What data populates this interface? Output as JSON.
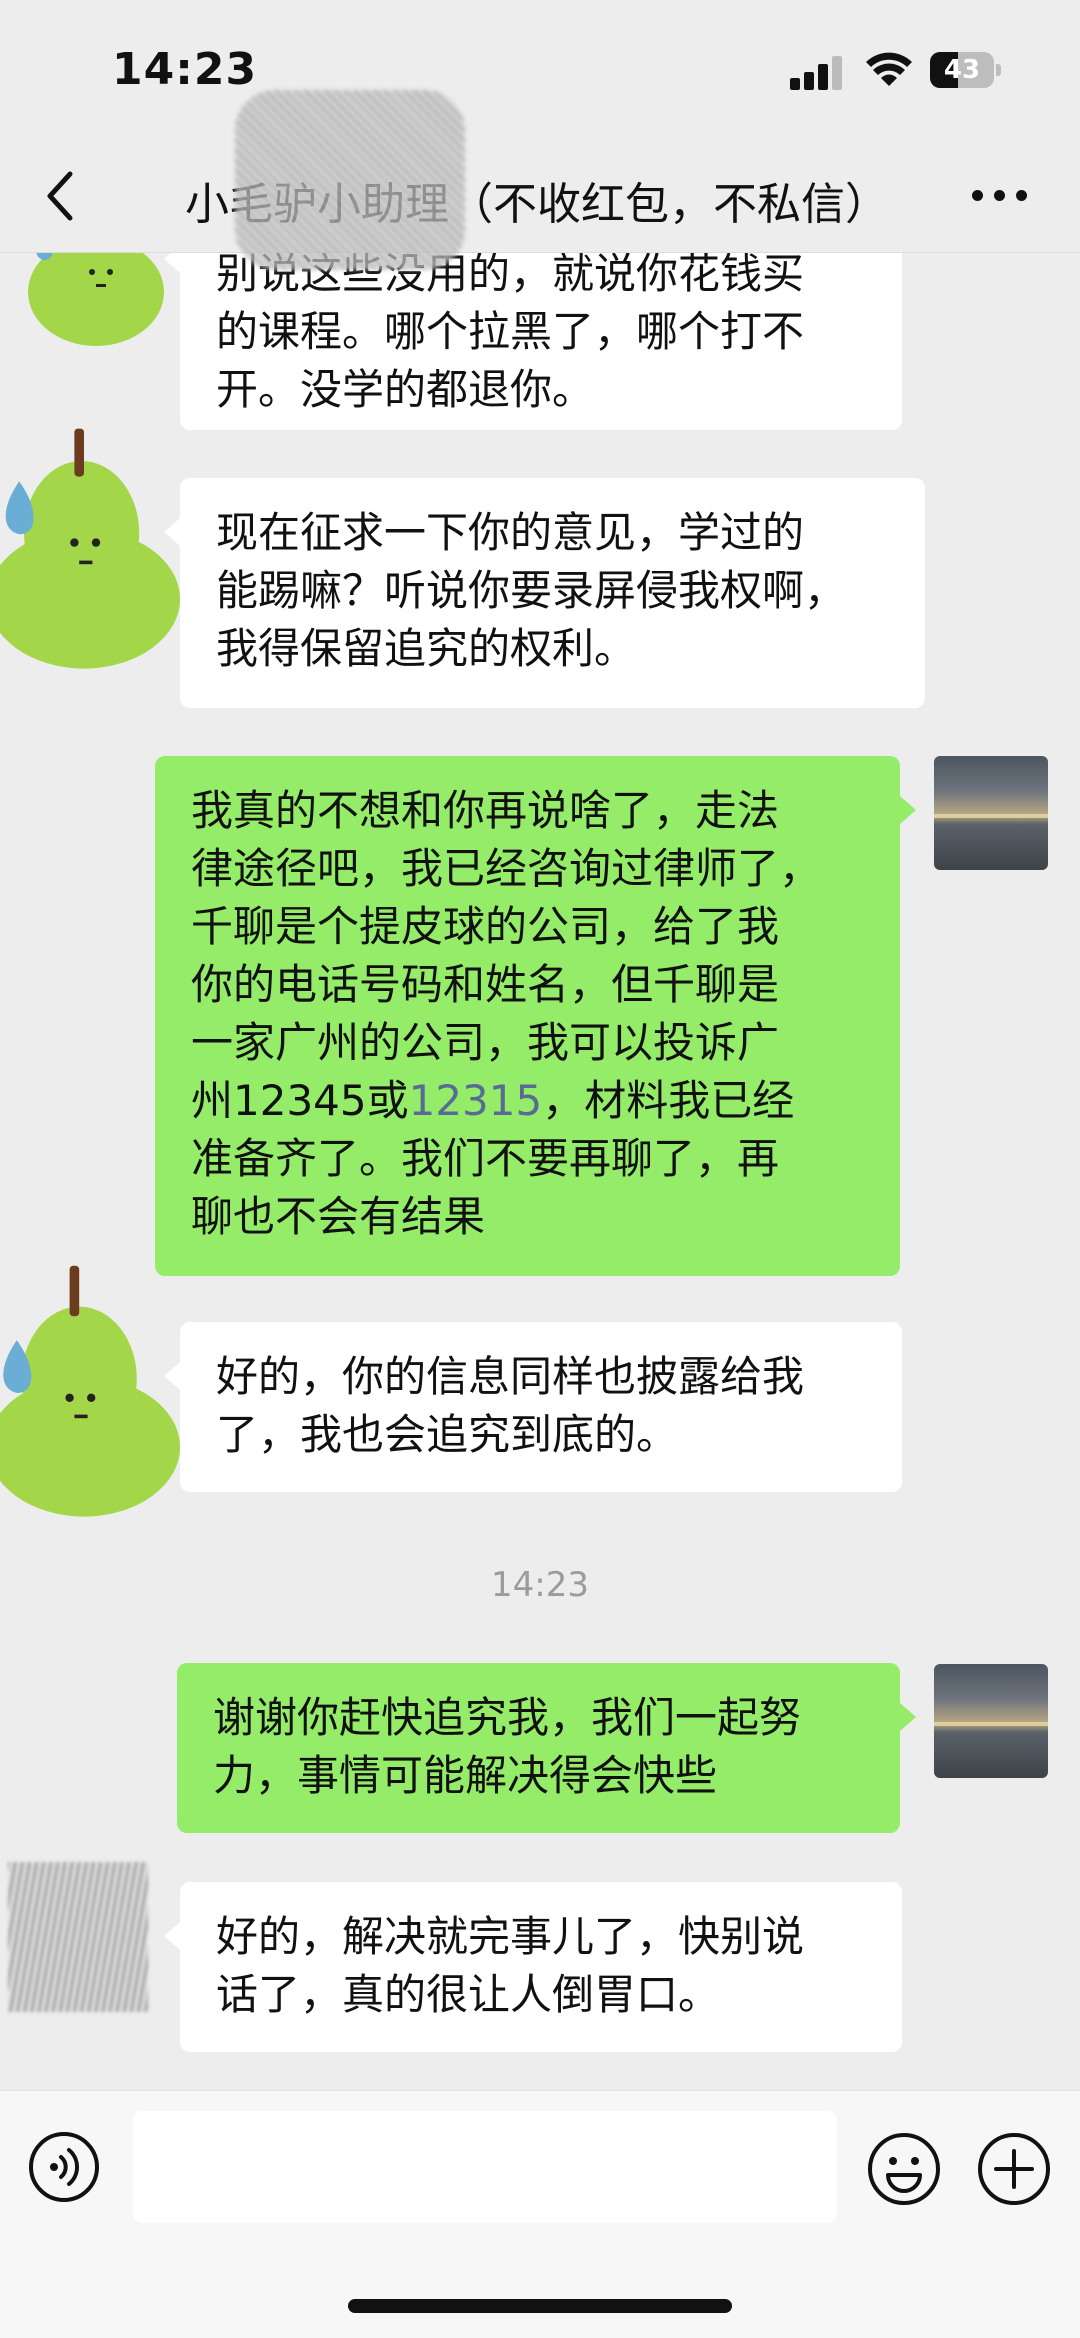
{
  "status_bar": {
    "time": "14:23",
    "battery_level": "43",
    "battery_fraction": 0.43
  },
  "nav": {
    "title": "小毛驴小助理（不收红包，不私信）",
    "back_icon": "chevron-left-icon",
    "more_icon": "more-dots-icon"
  },
  "messages": [
    {
      "side": "left",
      "avatar": "pear-avatar",
      "text": "别说这些没用的，就说你花钱买\n的课程。哪个拉黑了，哪个打不\n开。没学的都退你。"
    },
    {
      "side": "left",
      "avatar": "pear-avatar",
      "text": "现在征求一下你的意见，学过的\n能踢嘛？听说你要录屏侵我权啊，\n我得保留追究的权利。"
    },
    {
      "side": "right",
      "avatar": "sea-photo-avatar",
      "text_before": "我真的不想和你再说啥了，走法\n律途径吧，我已经咨询过律师了，\n千聊是个提皮球的公司，给了我\n你的电话号码和姓名，但千聊是\n一家广州的公司，我可以投诉广\n州12345或",
      "link": "12315",
      "text_after": "，材料我已经\n准备齐了。我们不要再聊了，再\n聊也不会有结果"
    },
    {
      "side": "left",
      "avatar": "pear-avatar",
      "text": "好的，你的信息同样也披露给我\n了，我也会追究到底的。"
    },
    {
      "side": "right",
      "avatar": "sea-photo-avatar",
      "text": "谢谢你赶快追究我，我们一起努\n力，事情可能解决得会快些"
    },
    {
      "side": "left",
      "avatar": "blurred-avatar",
      "text": "好的，解决就完事儿了，快别说\n话了，真的很让人倒胃口。"
    }
  ],
  "time_divider": "14:23",
  "input_bar": {
    "voice_icon": "voice-icon",
    "input_value": "",
    "emoji_icon": "emoji-icon",
    "plus_icon": "plus-icon"
  },
  "colors": {
    "background": "#ededed",
    "sent_bubble": "#95ec69",
    "received_bubble": "#ffffff",
    "link": "#576b95"
  }
}
